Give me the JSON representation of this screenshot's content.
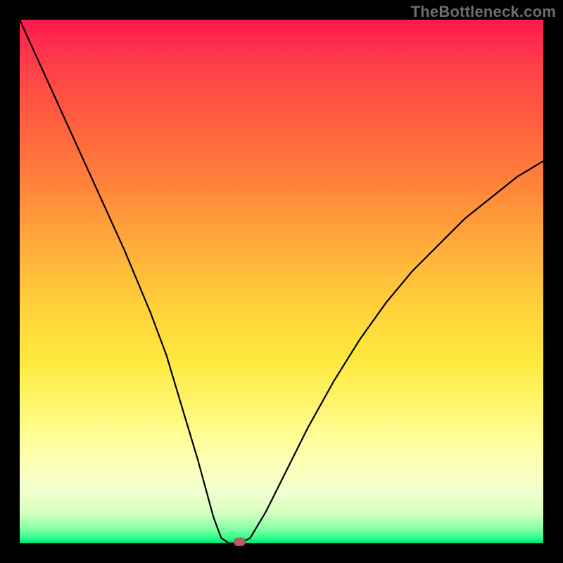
{
  "watermark": "TheBottleneck.com",
  "chart_data": {
    "type": "line",
    "title": "",
    "xlabel": "",
    "ylabel": "",
    "xlim": [
      0,
      100
    ],
    "ylim": [
      0,
      100
    ],
    "grid": false,
    "series": [
      {
        "name": "bottleneck-curve",
        "x": [
          0,
          5,
          10,
          15,
          20,
          25,
          28,
          31,
          34,
          37,
          38.5,
          40,
          42,
          44,
          47,
          50,
          55,
          60,
          65,
          70,
          75,
          80,
          85,
          90,
          95,
          100
        ],
        "y": [
          100,
          89,
          78,
          67,
          56,
          44,
          36,
          26,
          16,
          5,
          1,
          0,
          0,
          1,
          6,
          12,
          22,
          31,
          39,
          46,
          52,
          57,
          62,
          66,
          70,
          73
        ]
      }
    ],
    "marker": {
      "x": 42,
      "y": 0,
      "color": "#b95e5e"
    },
    "background_gradient": {
      "top": "#ff1a4d",
      "mid": "#ffe93e",
      "bottom": "#00de79"
    }
  }
}
